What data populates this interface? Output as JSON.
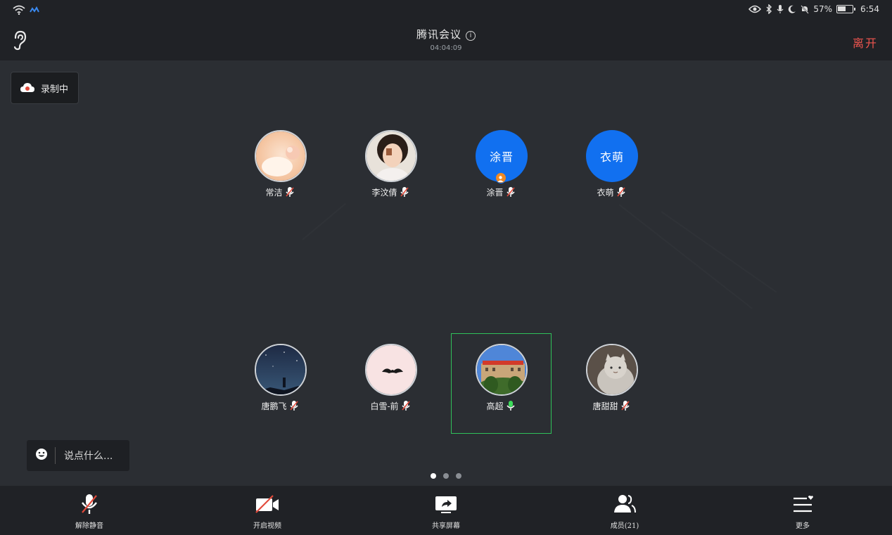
{
  "status_bar": {
    "battery_percent": "57%",
    "time": "6:54",
    "icons": [
      "wifi-icon",
      "signal-app-icon",
      "eye-icon",
      "bluetooth-icon",
      "mic-icon",
      "moon-icon",
      "bell-off-icon",
      "battery-icon"
    ]
  },
  "header": {
    "title": "腾讯会议",
    "timer": "04:04:09",
    "leave_label": "离开"
  },
  "recording": {
    "label": "录制中"
  },
  "participants": [
    {
      "name": "常洁",
      "avatar_type": "image",
      "mic": "muted"
    },
    {
      "name": "李汶倩",
      "avatar_type": "image",
      "mic": "muted"
    },
    {
      "name": "涂晋",
      "avatar_text": "涂晋",
      "avatar_type": "text",
      "mic": "muted",
      "host": true
    },
    {
      "name": "衣萌",
      "avatar_text": "衣萌",
      "avatar_type": "text",
      "mic": "muted"
    },
    {
      "name": "唐鹏飞",
      "avatar_type": "image",
      "mic": "muted"
    },
    {
      "name": "白雪-前",
      "avatar_type": "image",
      "mic": "muted"
    },
    {
      "name": "高超",
      "avatar_type": "image",
      "mic": "speaking",
      "active": true
    },
    {
      "name": "唐甜甜",
      "avatar_type": "image",
      "mic": "muted"
    }
  ],
  "chat": {
    "placeholder": "说点什么..."
  },
  "pagination": {
    "pages": 3,
    "current": 1
  },
  "toolbar": {
    "unmute_label": "解除静音",
    "video_label": "开启视频",
    "share_label": "共享屏幕",
    "members_label": "成员(21)",
    "more_label": "更多"
  },
  "colors": {
    "accent_blue": "#1170f0",
    "leave_red": "#f0554f",
    "active_green": "#2fc15a",
    "mute_red": "#e24a3b"
  }
}
